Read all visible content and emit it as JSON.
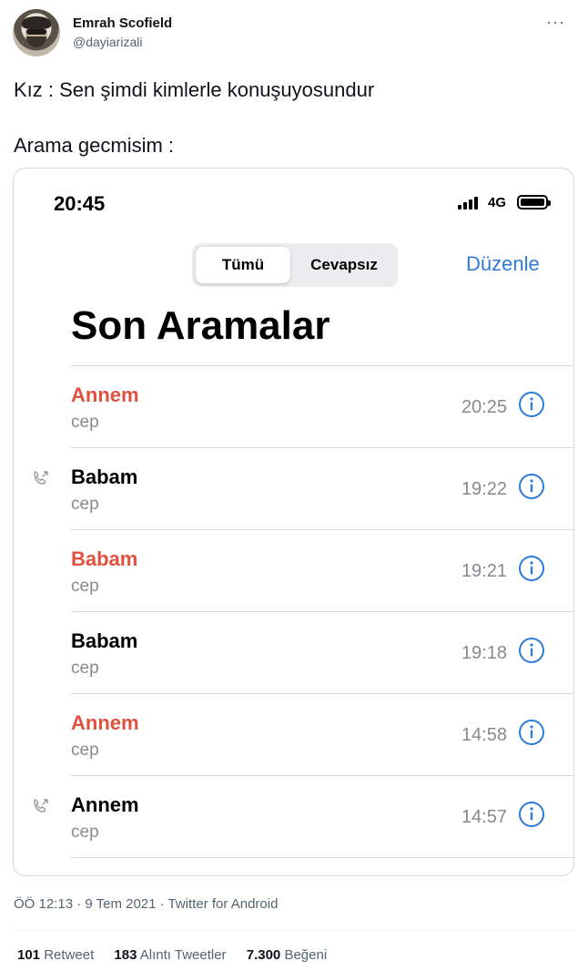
{
  "tweet": {
    "display_name": "Emrah Scofield",
    "handle": "@dayiarizali",
    "more_icon": "more-horizontal-icon",
    "lines": [
      "Kız : Sen şimdi kimlerle konuşuyosundur",
      "Arama gecmisim :"
    ],
    "timestamp": "ÖÖ 12:13 · 9 Tem 2021 · Twitter for Android",
    "stats": [
      {
        "count": "101",
        "label": "Retweet"
      },
      {
        "count": "183",
        "label": "Alıntı Tweetler"
      },
      {
        "count": "7.300",
        "label": "Beğeni"
      }
    ]
  },
  "phone": {
    "status_time": "20:45",
    "network": "4G",
    "segments": [
      "Tümü",
      "Cevapsız"
    ],
    "edit_label": "Düzenle",
    "title": "Son Aramalar",
    "colors": {
      "missed": "#e0523f",
      "accent": "#2f7bd6"
    },
    "calls": [
      {
        "name": "Annem",
        "kind": "cep",
        "time": "20:25",
        "missed": true,
        "outgoing": false
      },
      {
        "name": "Babam",
        "kind": "cep",
        "time": "19:22",
        "missed": false,
        "outgoing": true
      },
      {
        "name": "Babam",
        "kind": "cep",
        "time": "19:21",
        "missed": true,
        "outgoing": false
      },
      {
        "name": "Babam",
        "kind": "cep",
        "time": "19:18",
        "missed": false,
        "outgoing": false
      },
      {
        "name": "Annem",
        "kind": "cep",
        "time": "14:58",
        "missed": true,
        "outgoing": false
      },
      {
        "name": "Annem",
        "kind": "cep",
        "time": "14:57",
        "missed": false,
        "outgoing": true
      }
    ]
  }
}
